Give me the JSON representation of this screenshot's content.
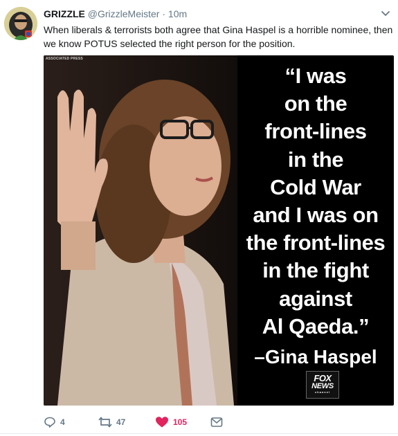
{
  "tweet": {
    "display_name": "GRIZZLE",
    "handle": "@GrizzleMeister",
    "separator": "·",
    "time": "10m",
    "text": "When liberals & terrorists both agree that Gina Haspel is a horrible nominee, then we know POTUS selected the right person for the position."
  },
  "media": {
    "credit": "ASSOCIATED PRESS",
    "quote_lines": [
      "“I was",
      "on the",
      "front-lines",
      "in the",
      "Cold War",
      "and I was on",
      "the front-lines",
      "in the fight",
      "against",
      "Al Qaeda.”"
    ],
    "attribution": "–Gina Haspel",
    "logo": {
      "line1": "FOX",
      "line2": "NEWS",
      "line3": "channel"
    }
  },
  "actions": {
    "reply_count": "4",
    "retweet_count": "47",
    "like_count": "105"
  },
  "colors": {
    "like": "#e0245e",
    "muted": "#657786",
    "text": "#14171a",
    "media_bg": "#000000"
  },
  "icons": [
    "avatar",
    "chevron-down-icon",
    "reply-icon",
    "retweet-icon",
    "heart-icon",
    "mail-icon"
  ]
}
